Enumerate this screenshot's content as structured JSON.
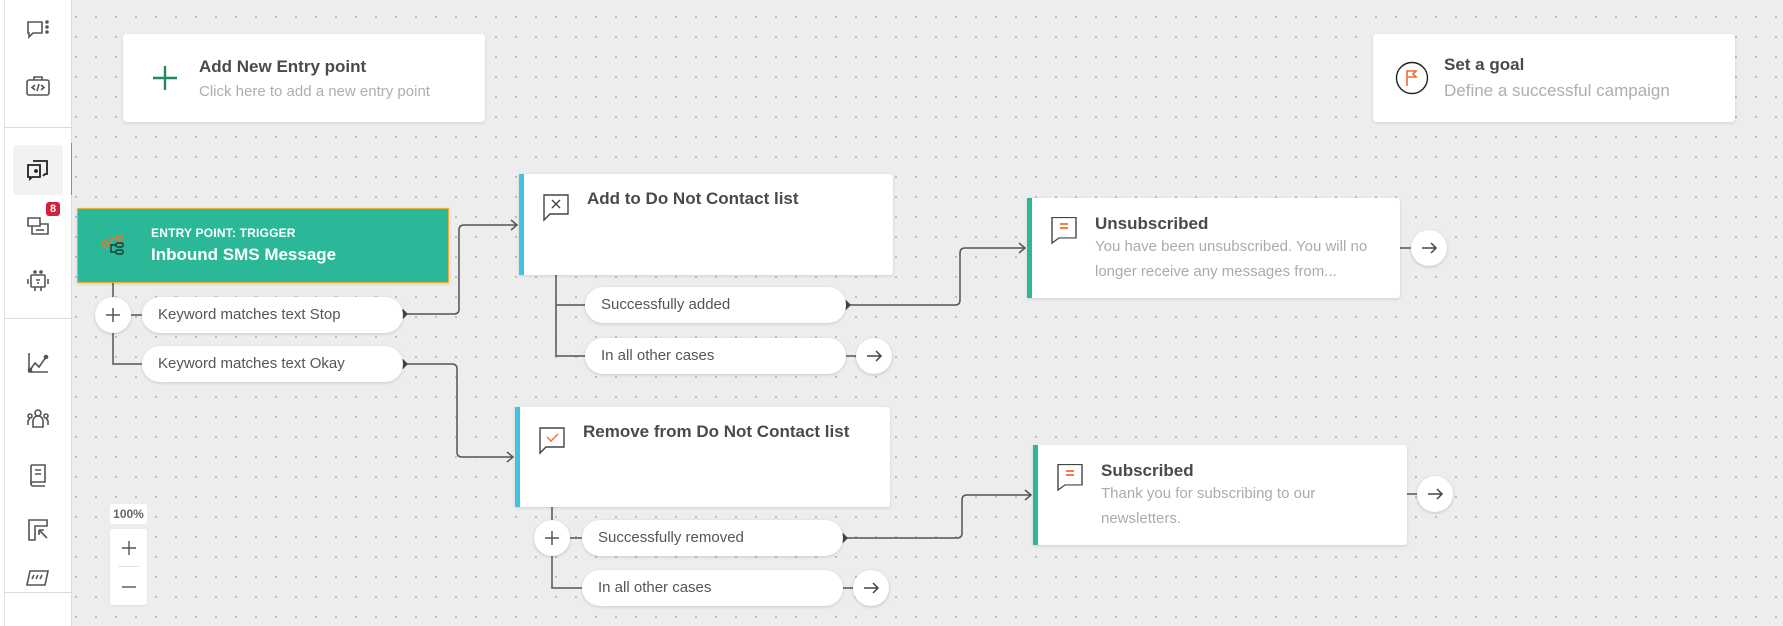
{
  "sidebar": {
    "items": [
      {
        "id": "conversations",
        "icon": "chat-menu-icon"
      },
      {
        "id": "developer",
        "icon": "code-briefcase-icon"
      },
      {
        "id": "campaigns",
        "icon": "chat-stack-icon",
        "active": true
      },
      {
        "id": "inbox",
        "icon": "messages-icon",
        "badge": "8"
      },
      {
        "id": "bots",
        "icon": "robot-icon"
      },
      {
        "id": "analytics",
        "icon": "chart-line-icon"
      },
      {
        "id": "contacts",
        "icon": "people-icon"
      },
      {
        "id": "library",
        "icon": "book-icon"
      },
      {
        "id": "selection",
        "icon": "cursor-frame-icon"
      },
      {
        "id": "more",
        "icon": "billing-icon"
      }
    ],
    "active_color": "#f26b35",
    "badge_color": "#d6203b"
  },
  "canvas": {
    "add_entry_point": {
      "title": "Add New Entry point",
      "subtitle": "Click here to add a new entry point"
    },
    "goal": {
      "title": "Set a goal",
      "subtitle": "Define a successful campaign"
    },
    "entry": {
      "kicker": "ENTRY POINT: TRIGGER",
      "name": "Inbound SMS Message",
      "color": "#2bb898",
      "branches": [
        {
          "label": "Keyword matches text Stop"
        },
        {
          "label": "Keyword matches text Okay"
        }
      ]
    },
    "nodes": [
      {
        "id": "add-dnc",
        "title": "Add to Do Not Contact list",
        "accent": "#40c4de",
        "branches": [
          {
            "label": "Successfully added"
          },
          {
            "label": "In all other cases"
          }
        ]
      },
      {
        "id": "remove-dnc",
        "title": "Remove from Do Not Contact list",
        "accent": "#40c4de",
        "branches": [
          {
            "label": "Successfully removed"
          },
          {
            "label": "In all other cases"
          }
        ]
      },
      {
        "id": "unsubscribed",
        "title": "Unsubscribed",
        "description": "You have been unsubscribed. You will no longer receive any messages from...",
        "accent": "#2bb898"
      },
      {
        "id": "subscribed",
        "title": "Subscribed",
        "description": "Thank you for subscribing to our newsletters.",
        "accent": "#2bb898"
      }
    ]
  },
  "zoom": {
    "level": "100%",
    "in_label": "+",
    "out_label": "−"
  }
}
